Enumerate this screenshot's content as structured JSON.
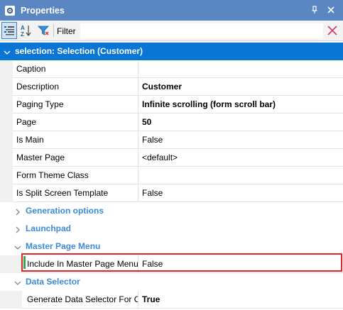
{
  "window": {
    "title": "Properties",
    "icon": "gear-icon"
  },
  "toolbar": {
    "filter_label": "Filter",
    "filter_value": "",
    "filter_placeholder": ""
  },
  "selection": {
    "header": "selection: Selection (Customer)"
  },
  "properties": [
    {
      "name": "Caption",
      "value": "",
      "bold": false
    },
    {
      "name": "Description",
      "value": "Customer",
      "bold": true
    },
    {
      "name": "Paging Type",
      "value": "Infinite scrolling (form scroll bar)",
      "bold": true
    },
    {
      "name": "Page",
      "value": "50",
      "bold": true
    },
    {
      "name": "Is Main",
      "value": "False",
      "bold": false
    },
    {
      "name": "Master Page",
      "value": "<default>",
      "bold": false
    },
    {
      "name": "Form Theme Class",
      "value": "",
      "bold": false
    },
    {
      "name": "Is Split Screen Template",
      "value": "False",
      "bold": false
    }
  ],
  "categories": {
    "generation_options": "Generation options",
    "launchpad": "Launchpad",
    "master_page_menu": "Master Page Menu",
    "data_selector": "Data Selector"
  },
  "master_page_menu_props": [
    {
      "name": "Include In Master Page Menu",
      "value": "False"
    }
  ],
  "data_selector_props": [
    {
      "name": "Generate Data Selector For Co",
      "value": "True"
    }
  ],
  "colors": {
    "title_bar": "#5a86c2",
    "selection_header": "#0a75d4",
    "category_text": "#3c8ad8",
    "highlight_border": "#e0242c",
    "modified_marker": "#2fa84f"
  }
}
